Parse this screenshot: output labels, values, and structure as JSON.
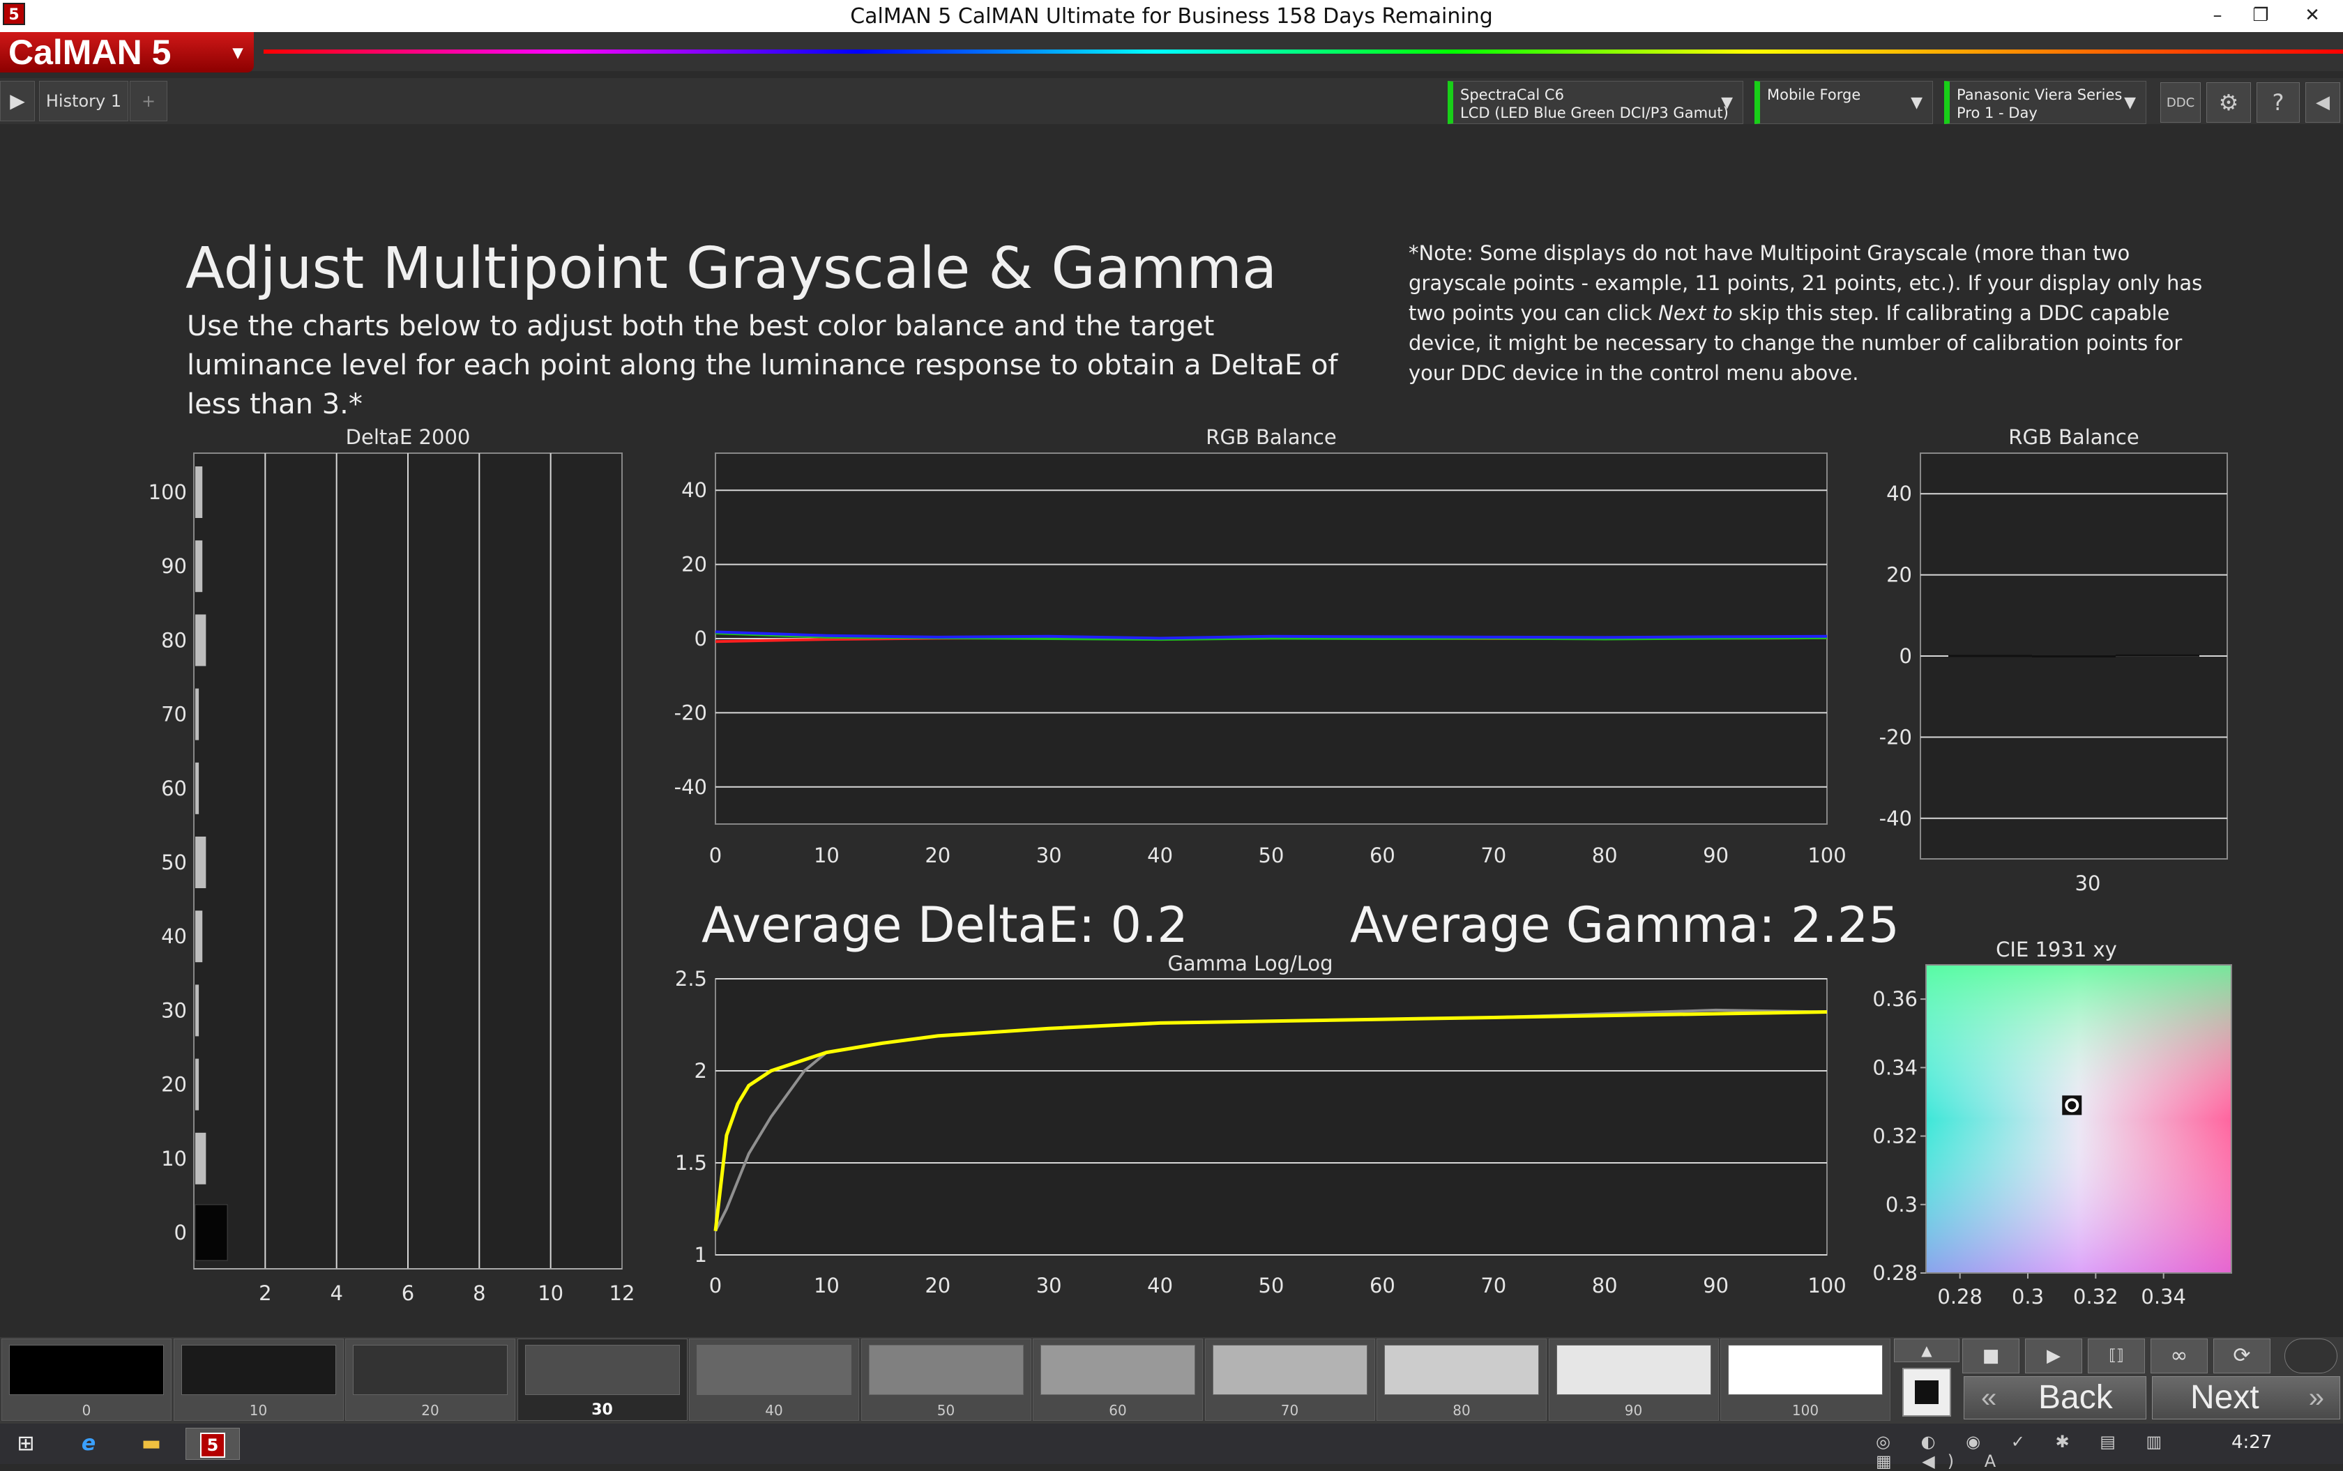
{
  "window": {
    "title": "CalMAN 5 CalMAN Ultimate for Business 158 Days Remaining",
    "app_icon": "5",
    "minimize": "–",
    "restore": "❐",
    "close": "✕"
  },
  "app": {
    "logo": "CalMAN 5",
    "logo_dropdown": "▾"
  },
  "tabs": {
    "play": "▶",
    "history": "History 1",
    "add": "+"
  },
  "devices": {
    "meter_line1": "SpectraCal C6",
    "meter_line2": "LCD (LED Blue Green DCI/P3 Gamut)",
    "source": "Mobile Forge",
    "display_line1": "Panasonic Viera Series",
    "display_line2": "Pro 1 - Day",
    "ddc": "DDC",
    "settings_icon": "⚙",
    "help_icon": "?",
    "collapse_icon": "◀"
  },
  "page": {
    "heading": "Adjust Multipoint Grayscale & Gamma",
    "subheading": "Use the charts below to adjust both the best color balance and the target luminance level for each point along the luminance response to obtain a DeltaE of less than 3.*",
    "note_before": "*Note: Some displays do not have Multipoint Grayscale (more than two grayscale points - example, 11 points, 21 points, etc.). If your display only has two points you can click ",
    "note_emph": "Next to",
    "note_after": " skip this step.  If calibrating a DDC capable device, it might be necessary to change the number of calibration points for your DDC device in the control menu above.",
    "avg_deltae": "Average DeltaE: 0.2",
    "avg_gamma": "Average Gamma: 2.25"
  },
  "chart_data": [
    {
      "type": "bar",
      "title": "DeltaE 2000",
      "orientation": "horizontal",
      "categories": [
        "0",
        "10",
        "20",
        "30",
        "40",
        "50",
        "60",
        "70",
        "80",
        "90",
        "100"
      ],
      "values": [
        0.9,
        0.3,
        0.1,
        0.1,
        0.2,
        0.3,
        0.1,
        0.1,
        0.3,
        0.2,
        0.2
      ],
      "xlim": [
        0,
        12
      ],
      "xticks": [
        "2",
        "4",
        "6",
        "8",
        "10",
        "12"
      ],
      "yticks": [
        "0",
        "10",
        "20",
        "30",
        "40",
        "50",
        "60",
        "70",
        "80",
        "90",
        "100"
      ]
    },
    {
      "type": "line",
      "title": "RGB Balance",
      "x": [
        0,
        10,
        20,
        30,
        40,
        50,
        60,
        70,
        80,
        90,
        100
      ],
      "series": [
        {
          "color": "#ff2020",
          "values": [
            -0.8,
            -0.2,
            0.1,
            0.2,
            -0.1,
            0.1,
            0.1,
            0.0,
            0.1,
            0.1,
            0.2
          ]
        },
        {
          "color": "#20c020",
          "values": [
            1.5,
            0.4,
            0.2,
            0.0,
            -0.2,
            0.1,
            0.0,
            0.1,
            -0.1,
            0.1,
            0.2
          ]
        },
        {
          "color": "#2020ff",
          "values": [
            1.8,
            0.8,
            0.4,
            0.6,
            0.1,
            0.6,
            0.5,
            0.4,
            0.3,
            0.5,
            0.6
          ]
        }
      ],
      "xlim": [
        0,
        100
      ],
      "ylim": [
        -50,
        50
      ],
      "xticks": [
        "0",
        "10",
        "20",
        "30",
        "40",
        "50",
        "60",
        "70",
        "80",
        "90",
        "100"
      ],
      "yticks": [
        "40",
        "20",
        "0",
        "-20",
        "-40"
      ]
    },
    {
      "type": "bar",
      "title": "RGB Balance",
      "categories": [
        "30"
      ],
      "series": [
        {
          "color": "#ff2020",
          "values": [
            0.1
          ]
        },
        {
          "color": "#20c020",
          "values": [
            0.0
          ]
        },
        {
          "color": "#2020ff",
          "values": [
            0.2
          ]
        }
      ],
      "ylim": [
        -50,
        50
      ],
      "yticks": [
        "40",
        "20",
        "0",
        "-20",
        "-40"
      ]
    },
    {
      "type": "line",
      "title": "Gamma Log/Log",
      "x": [
        0,
        1,
        2,
        3,
        5,
        8,
        10,
        15,
        20,
        30,
        40,
        50,
        60,
        70,
        80,
        90,
        100
      ],
      "series": [
        {
          "color": "#ffff00",
          "values": [
            1.13,
            1.65,
            1.82,
            1.92,
            2.0,
            2.06,
            2.1,
            2.15,
            2.19,
            2.23,
            2.26,
            2.27,
            2.28,
            2.29,
            2.3,
            2.31,
            2.32
          ]
        },
        {
          "color": "#909090",
          "values": [
            1.13,
            1.25,
            1.4,
            1.55,
            1.75,
            2.0,
            2.1,
            2.15,
            2.19,
            2.23,
            2.26,
            2.27,
            2.28,
            2.29,
            2.31,
            2.33,
            2.32
          ]
        }
      ],
      "xlim": [
        0,
        100
      ],
      "ylim": [
        1,
        2.5
      ],
      "xticks": [
        "0",
        "10",
        "20",
        "30",
        "40",
        "50",
        "60",
        "70",
        "80",
        "90",
        "100"
      ],
      "yticks": [
        "2.5",
        "2",
        "1.5",
        "1"
      ]
    },
    {
      "type": "scatter",
      "title": "CIE 1931 xy",
      "points": [
        {
          "x": 0.313,
          "y": 0.329
        }
      ],
      "xlim": [
        0.27,
        0.36
      ],
      "ylim": [
        0.28,
        0.37
      ],
      "xticks": [
        "0.28",
        "0.3",
        "0.32",
        "0.34"
      ],
      "yticks": [
        "0.36",
        "0.34",
        "0.32",
        "0.3",
        "0.28"
      ]
    }
  ],
  "patches": [
    {
      "label": "0",
      "color": "#000000"
    },
    {
      "label": "10",
      "color": "#1a1a1a"
    },
    {
      "label": "20",
      "color": "#333333"
    },
    {
      "label": "30",
      "color": "#4d4d4d",
      "selected": true
    },
    {
      "label": "40",
      "color": "#666666"
    },
    {
      "label": "50",
      "color": "#808080"
    },
    {
      "label": "60",
      "color": "#999999"
    },
    {
      "label": "70",
      "color": "#b3b3b3"
    },
    {
      "label": "80",
      "color": "#cccccc"
    },
    {
      "label": "90",
      "color": "#e6e6e6"
    },
    {
      "label": "100",
      "color": "#ffffff"
    }
  ],
  "controls": {
    "up_icon": "▲",
    "stop_icon": "■",
    "pause_icon": "●",
    "play_icon": "▶",
    "measure_icon": "⟦⟧",
    "loop_icon": "∞",
    "refresh_icon": "⟳",
    "back_label": "Back",
    "back_icon": "«",
    "next_label": "Next",
    "next_icon": "»"
  },
  "taskbar": {
    "start_icon": "⊞",
    "ie_icon": "e",
    "folder_icon": "▬",
    "calman_icon": "5",
    "time": "4:27"
  }
}
